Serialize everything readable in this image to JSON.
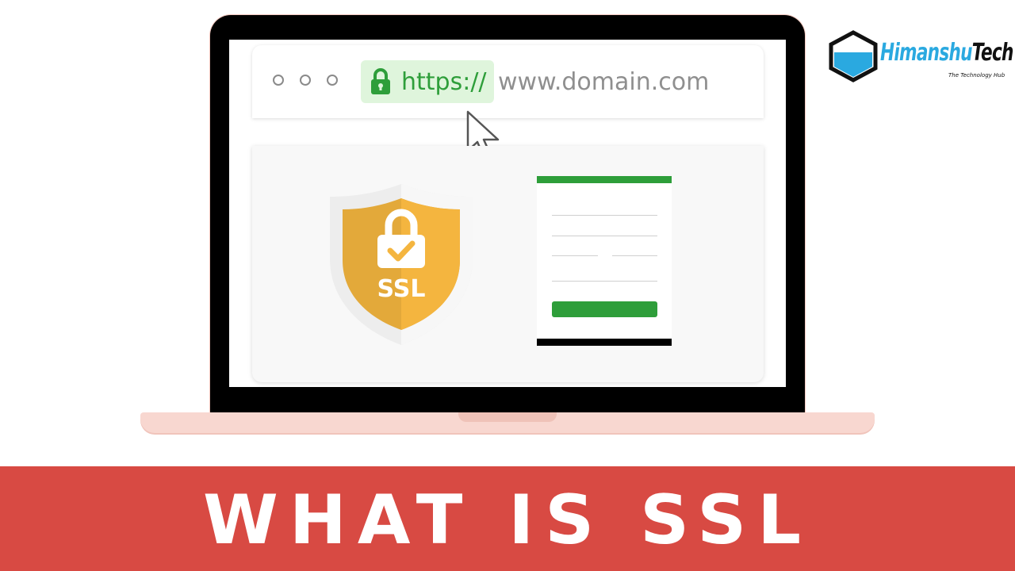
{
  "browser": {
    "protocol": "https://",
    "domain": "www.domain.com"
  },
  "badge": {
    "label": "SSL"
  },
  "logo": {
    "name_part1": "Himanshu",
    "name_part2": "Tech",
    "tagline": "The Technology Hub"
  },
  "banner": {
    "title": "WHAT IS SSL"
  },
  "colors": {
    "accent_green": "#2e9e3a",
    "banner_red": "#d84a43",
    "shield_gold": "#f4b53f",
    "laptop_pink": "#f8d7d0"
  }
}
